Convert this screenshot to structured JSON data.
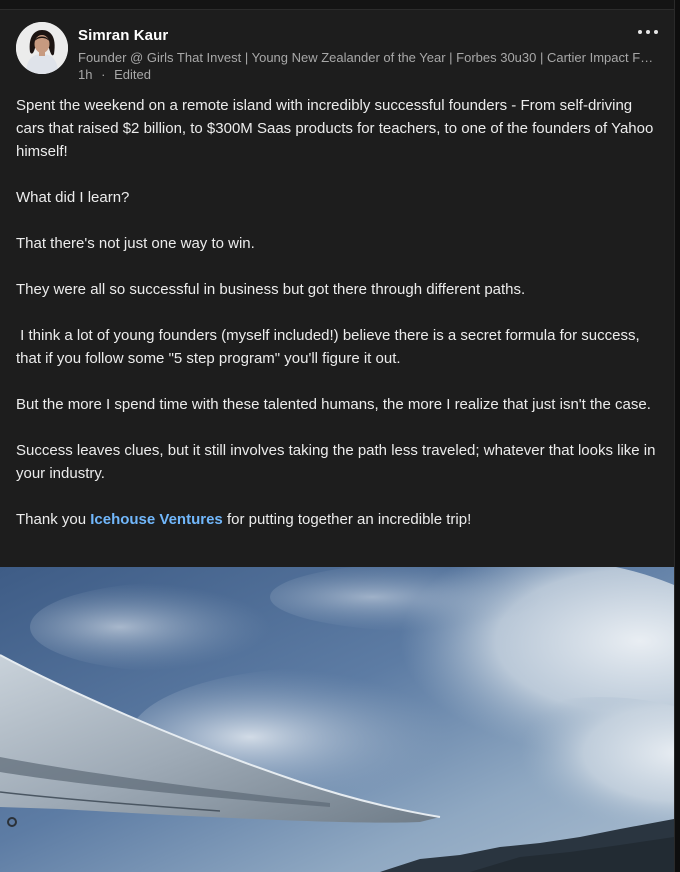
{
  "post": {
    "author": {
      "name": "Simran Kaur",
      "headline": "Founder @ Girls That Invest | Young New Zealander of the Year | Forbes 30u30 | Cartier Impact Fel…",
      "time": "1h",
      "separator": "·",
      "edited": "Edited"
    },
    "more_icon": "more-horizontal-icon",
    "paragraphs": [
      "Spent the weekend on a remote island with incredibly successful founders - From self-driving cars that raised $2 billion, to $300M Saas products for teachers, to one of the founders of Yahoo himself!",
      "What did I learn?",
      "That there's not just one way to win.",
      "They were all so successful in business but got there through different paths.",
      " I think a lot of young founders (myself included!) believe there is a secret formula for success, that if you follow some \"5 step program\" you'll figure it out.",
      "But the more I spend time with these talented humans, the more I realize that just isn't the case.",
      "Success leaves clues, but it still involves taking the path less traveled; whatever that looks like in your industry."
    ],
    "closing": {
      "before": "Thank you ",
      "link": "Icehouse Ventures",
      "after": " for putting together an incredible trip!"
    },
    "image": {
      "subject": "airplane-wing-over-clouds-photo"
    }
  },
  "colors": {
    "card_bg": "#1d1d1d",
    "text": "#ececec",
    "muted": "#a8a8a8",
    "link": "#71b7fb"
  }
}
